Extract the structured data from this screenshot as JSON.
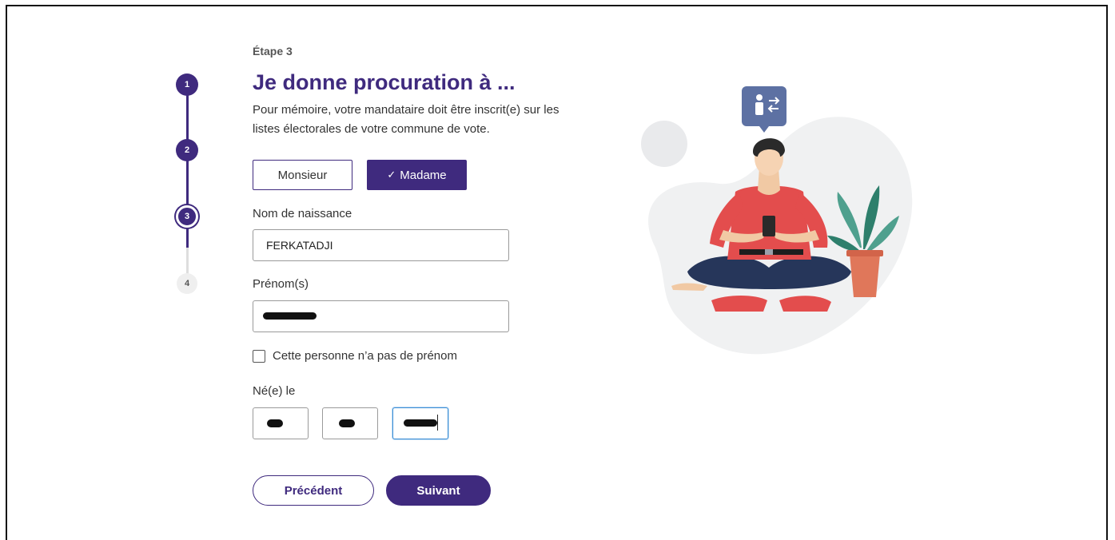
{
  "stepper": {
    "steps": [
      "1",
      "2",
      "3",
      "4"
    ],
    "current": 3
  },
  "header": {
    "eyebrow": "Étape 3",
    "title": "Je donne procuration à ...",
    "lead": "Pour mémoire, votre mandataire doit être inscrit(e) sur les listes électorales de votre commune de vote."
  },
  "civility": {
    "option_m": "Monsieur",
    "option_f": "Madame",
    "selected": "Madame"
  },
  "form": {
    "birth_name_label": "Nom de naissance",
    "birth_name_value": "FERKATADJI",
    "firstname_label": "Prénom(s)",
    "no_firstname_label": "Cette personne n’a pas de prénom",
    "no_firstname_checked": false,
    "birthdate_label": "Né(e) le"
  },
  "actions": {
    "prev_label": "Précédent",
    "next_label": "Suivant"
  },
  "colors": {
    "primary": "#3f2a7e",
    "focus": "#3d8fd6"
  },
  "icons": [
    "checkmark-icon",
    "transfer-person-icon"
  ]
}
